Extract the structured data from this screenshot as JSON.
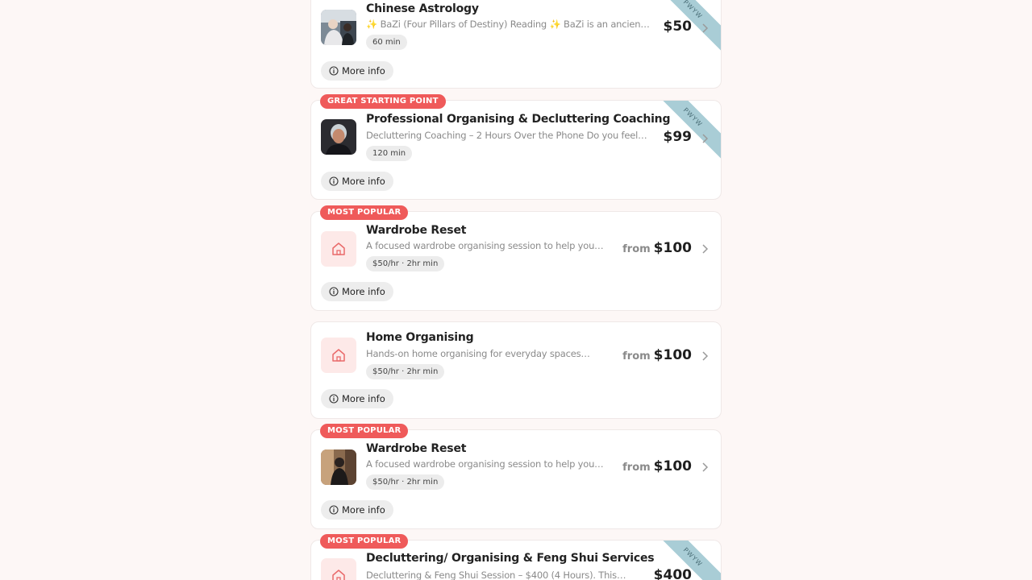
{
  "services": [
    {
      "badge": "",
      "title": "Chinese Astrology",
      "description": "✨ BaZi (Four Pillars of Destiny) Reading ✨ BaZi is an ancient…",
      "chip": "60 min",
      "price_prefix": "",
      "price": "$50",
      "ribbon": "PWYW",
      "thumb": "photo-person-icon",
      "more_info": "More info"
    },
    {
      "badge": "GREAT STARTING POINT",
      "title": "Professional Organising & Decluttering Coaching",
      "description": "Decluttering Coaching – 2 Hours Over the Phone Do you feel…",
      "chip": "120 min",
      "price_prefix": "",
      "price": "$99",
      "ribbon": "PWYW",
      "thumb": "photo-portrait-icon",
      "more_info": "More info"
    },
    {
      "badge": "MOST POPULAR",
      "title": "Wardrobe Reset",
      "description": "A focused wardrobe organising session to help you…",
      "chip": "$50/hr · 2hr min",
      "price_prefix": "from",
      "price": "$100",
      "ribbon": "",
      "thumb": "house-icon",
      "more_info": "More info"
    },
    {
      "badge": "",
      "title": "Home Organising",
      "description": "Hands-on home organising for everyday spaces…",
      "chip": "$50/hr · 2hr min",
      "price_prefix": "from",
      "price": "$100",
      "ribbon": "",
      "thumb": "house-icon",
      "more_info": "More info"
    },
    {
      "badge": "MOST POPULAR",
      "title": "Wardrobe Reset",
      "description": "A focused wardrobe organising session to help you…",
      "chip": "$50/hr · 2hr min",
      "price_prefix": "from",
      "price": "$100",
      "ribbon": "",
      "thumb": "photo-wardrobe-icon",
      "more_info": "More info"
    },
    {
      "badge": "MOST POPULAR",
      "title": "Decluttering/ Organising & Feng Shui Services",
      "description": "Decluttering & Feng Shui Session – $400 (4 Hours). This…",
      "chip": "",
      "price_prefix": "",
      "price": "$400",
      "ribbon": "PWYW",
      "thumb": "house-icon",
      "more_info": ""
    }
  ],
  "colors": {
    "badge": "#ef5a5a",
    "ribbon": "#a9cdd6",
    "house_icon": "#e96a6a",
    "house_bg": "#fde9e8"
  }
}
